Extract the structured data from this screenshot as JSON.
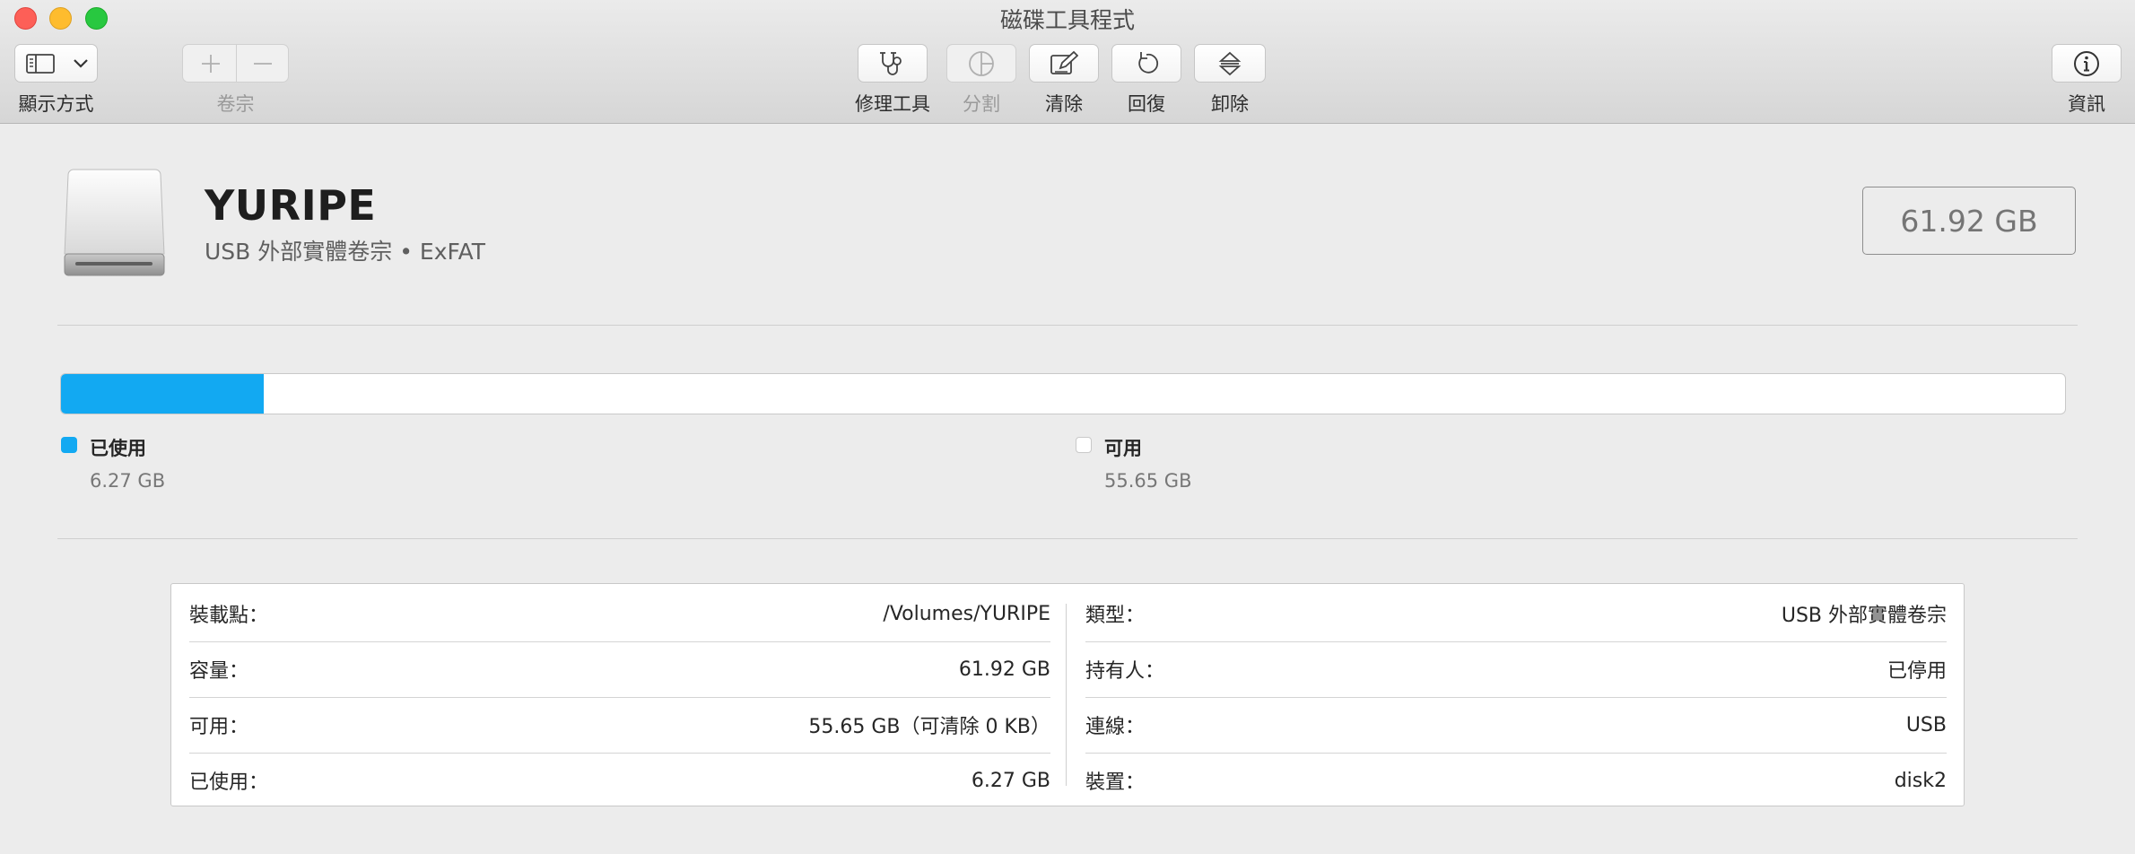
{
  "window": {
    "title": "磁碟工具程式"
  },
  "toolbar": {
    "view_label": "顯示方式",
    "volume_label": "卷宗",
    "first_aid_label": "修理工具",
    "partition_label": "分割",
    "erase_label": "清除",
    "restore_label": "回復",
    "unmount_label": "卸除",
    "info_label": "資訊"
  },
  "volume": {
    "name": "YURIPE",
    "subtitle": "USB 外部實體卷宗 • ExFAT",
    "capacity": "61.92 GB"
  },
  "usage": {
    "used_fraction": 0.1013,
    "used_color": "#12a9f2",
    "free_color": "#ffffff",
    "used_title": "已使用",
    "used_value": "6.27 GB",
    "free_title": "可用",
    "free_value": "55.65 GB"
  },
  "info": {
    "left": [
      {
        "label": "裝載點：",
        "value": "/Volumes/YURIPE"
      },
      {
        "label": "容量：",
        "value": "61.92 GB"
      },
      {
        "label": "可用：",
        "value": "55.65 GB（可清除 0 KB）"
      },
      {
        "label": "已使用：",
        "value": "6.27 GB"
      }
    ],
    "right": [
      {
        "label": "類型：",
        "value": "USB 外部實體卷宗"
      },
      {
        "label": "持有人：",
        "value": "已停用"
      },
      {
        "label": "連線：",
        "value": "USB"
      },
      {
        "label": "裝置：",
        "value": "disk2"
      }
    ]
  },
  "icons": [
    "sidebar-icon",
    "chevron-down-icon",
    "plus-icon",
    "minus-icon",
    "stethoscope-icon",
    "pie-chart-icon",
    "pencil-icon",
    "restore-icon",
    "eject-icon",
    "info-icon",
    "external-drive-icon"
  ]
}
